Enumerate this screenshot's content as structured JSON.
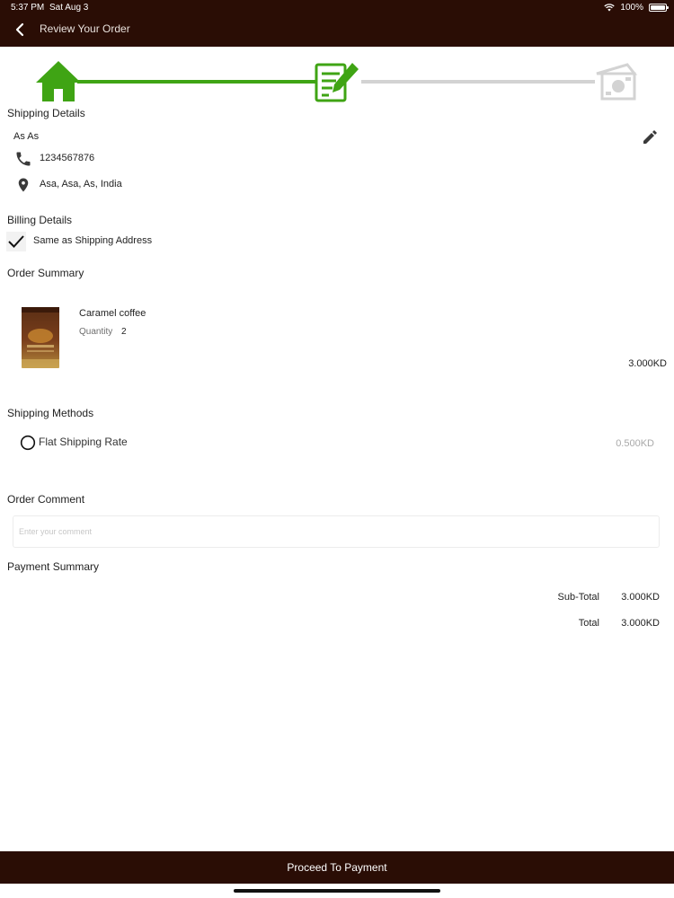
{
  "status_bar": {
    "time": "5:37 PM",
    "date": "Sat Aug 3",
    "battery": "100%"
  },
  "header": {
    "title": "Review Your Order"
  },
  "shipping": {
    "heading": "Shipping Details",
    "name": "As As",
    "phone": "1234567876",
    "address": "Asa, Asa, As, India"
  },
  "billing": {
    "heading": "Billing Details",
    "same_as_shipping_label": "Same as Shipping Address",
    "same_as_shipping_checked": true
  },
  "order_summary": {
    "heading": "Order Summary",
    "items": [
      {
        "name": "Caramel coffee",
        "quantity_label": "Quantity",
        "quantity": "2",
        "price": "3.000KD"
      }
    ]
  },
  "shipping_methods": {
    "heading": "Shipping Methods",
    "options": [
      {
        "label": "Flat Shipping Rate",
        "price": "0.500KD",
        "selected": false
      }
    ]
  },
  "order_comment": {
    "heading": "Order Comment",
    "placeholder": "Enter your comment",
    "value": ""
  },
  "payment_summary": {
    "heading": "Payment Summary",
    "subtotal_label": "Sub-Total",
    "subtotal": "3.000KD",
    "total_label": "Total",
    "total": "3.000KD"
  },
  "footer": {
    "proceed_label": "Proceed To Payment"
  },
  "colors": {
    "brand_dark": "#2a0d05",
    "step_active": "#3fa414",
    "step_inactive": "#d3d3d3"
  }
}
